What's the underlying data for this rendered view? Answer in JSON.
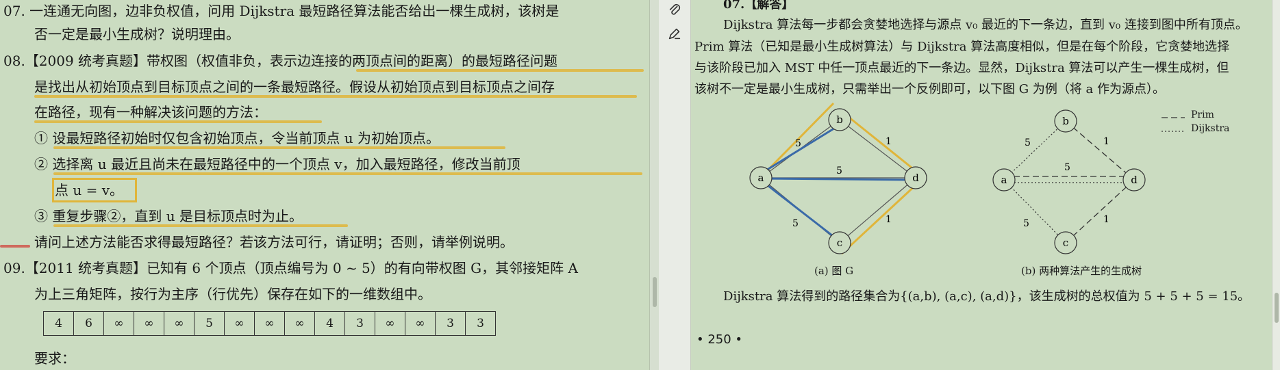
{
  "left": {
    "lines": [
      "07.  一连通无向图，边非负权值，问用 Dijkstra 最短路径算法能否给出一棵生成树，该树是",
      "否一定是最小生成树？说明理由。",
      "08.【2009 统考真题】带权图（权值非负，表示边连接的两顶点间的距离）的最短路径问题",
      "是找出从初始顶点到目标顶点之间的一条最短路径。假设从初始顶点到目标顶点之间存",
      "在路径，现有一种解决该问题的方法：",
      "① 设最短路径初始时仅包含初始顶点，令当前顶点 u 为初始顶点。",
      "② 选择离 u 最近且尚未在最短路径中的一个顶点 v，加入最短路径，修改当前顶",
      "点 u = v。",
      "③ 重复步骤②，直到 u 是目标顶点时为止。",
      "请问上述方法能否求得最短路径？若该方法可行，请证明；否则，请举例说明。",
      "09.【2011 统考真题】已知有 6 个顶点（顶点编号为 0 ~ 5）的有向带权图 G，其邻接矩阵 A",
      "为上三角矩阵，按行为主序（行优先）保存在如下的一维数组中。",
      "要求："
    ],
    "array": [
      "4",
      "6",
      "∞",
      "∞",
      "∞",
      "5",
      "∞",
      "∞",
      "∞",
      "4",
      "3",
      "∞",
      "∞",
      "3",
      "3"
    ]
  },
  "right": {
    "heading": "07.【解答】",
    "lines": [
      "Dijkstra 算法每一步都会贪婪地选择与源点 v₀ 最近的下一条边，直到 v₀ 连接到图中所有顶点。",
      "Prim 算法（已知是最小生成树算法）与 Dijkstra 算法高度相似，但是在每个阶段，它贪婪地选择",
      "与该阶段已加入 MST 中任一顶点最近的下一条边。显然，Dijkstra 算法可以产生一棵生成树，但",
      "该树不一定是最小生成树，只需举出一个反例即可，以下图 G 为例（将 a 作为源点）。"
    ],
    "figure_a_caption": "(a) 图 G",
    "figure_b_caption": "(b) 两种算法产生的生成树",
    "legend_prim": "Prim",
    "legend_dijkstra": "Dijkstra",
    "nodes": {
      "a": "a",
      "b": "b",
      "c": "c",
      "d": "d"
    },
    "weights": {
      "ab": "5",
      "bd": "1",
      "ad": "5",
      "ac": "5",
      "cd": "1"
    },
    "conclusion": "Dijkstra 算法得到的路径集合为{(a,b), (a,c), (a,d)}，该生成树的总权值为 5 + 5 + 5 = 15。",
    "page_number": "• 250 •"
  },
  "toolbar": {
    "icons": [
      "paperclip-icon",
      "sign-pen-icon"
    ]
  },
  "colors": {
    "page": "#cbdcc1",
    "highlight": "#e0b53a",
    "ink": "#3a6aa8",
    "red_mark": "#d0564b"
  }
}
